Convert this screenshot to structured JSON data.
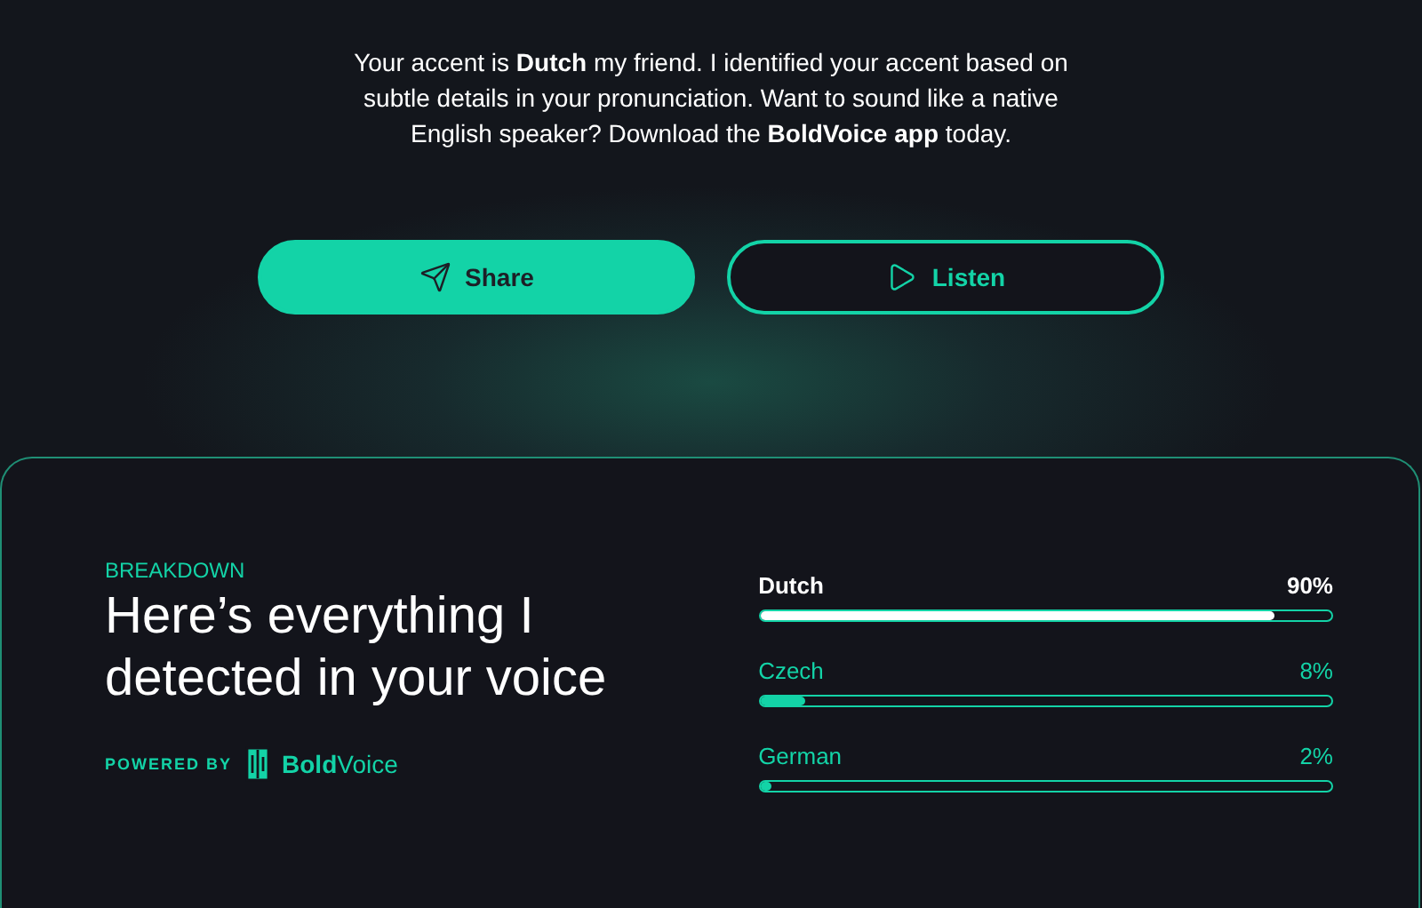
{
  "message": "Your accent is **Dutch** my friend. I identified your accent based on subtle details in your pronunciation. Want to sound like a native English speaker? Download the **BoldVoice app** today.",
  "buttons": [
    {
      "label": "Share",
      "kind": "primary"
    },
    {
      "label": "Listen",
      "kind": "outline"
    }
  ],
  "breakdown": {
    "eyebrow": "BREAKDOWN",
    "title": "Here’s everything I detected in your voice",
    "powered_by": "POWERED BY",
    "brand": "**Bold**Voice",
    "accents": [
      {
        "name": "Dutch",
        "reading": "90%",
        "level": 0.9,
        "selected": true
      },
      {
        "name": "Czech",
        "reading": "8%",
        "level": 0.08,
        "selected": false
      },
      {
        "name": "German",
        "reading": "2%",
        "level": 0.02,
        "selected": false
      }
    ]
  }
}
